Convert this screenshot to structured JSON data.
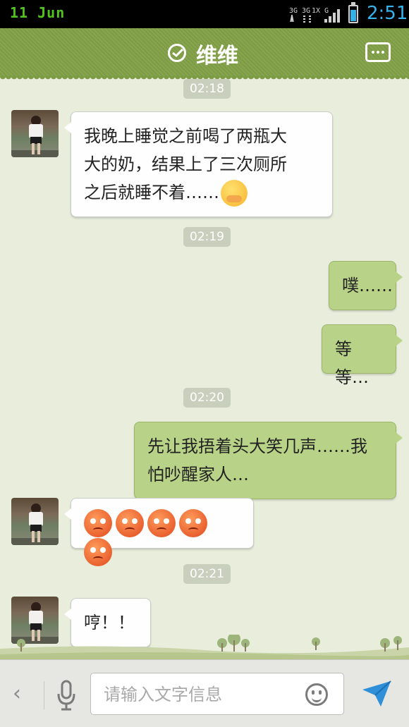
{
  "status_bar": {
    "date": "11 Jun",
    "network_3g_a": "3G",
    "network_3g_b": "3G",
    "network_1x": "1X",
    "network_g": "G",
    "time": "2:51",
    "battery_level": 0.72,
    "colors": {
      "date": "#52c31e",
      "time": "#35b3ea"
    }
  },
  "header": {
    "title": "维维",
    "verified_icon": "check-circle-icon",
    "more_icon": "more-dots-icon",
    "color": "#87a54f"
  },
  "chat": {
    "timestamps": [
      "02:18",
      "02:19",
      "02:20",
      "02:21"
    ],
    "messages": [
      {
        "side": "left",
        "text_line1": "我晚上睡觉之前喝了两瓶大",
        "text_line2": "大的奶，结果上了三次厕所",
        "text_line3": "之后就睡不着……",
        "emoji": "shy-emoji"
      },
      {
        "side": "right",
        "text": "噗……"
      },
      {
        "side": "right",
        "text": "等等…"
      },
      {
        "side": "right",
        "text_line1": "先让我捂着头大笑几声……我",
        "text_line2": "怕吵醒家人…"
      },
      {
        "side": "left",
        "emojis": [
          "angry-emoji",
          "angry-emoji",
          "angry-emoji",
          "angry-emoji",
          "angry-emoji"
        ]
      },
      {
        "side": "left",
        "text": "哼！！"
      }
    ]
  },
  "input_bar": {
    "placeholder": "请输入文字信息",
    "value": "",
    "back_icon": "chevron-left-icon",
    "voice_icon": "microphone-icon",
    "emoji_icon": "smiley-icon",
    "send_icon": "send-icon"
  }
}
